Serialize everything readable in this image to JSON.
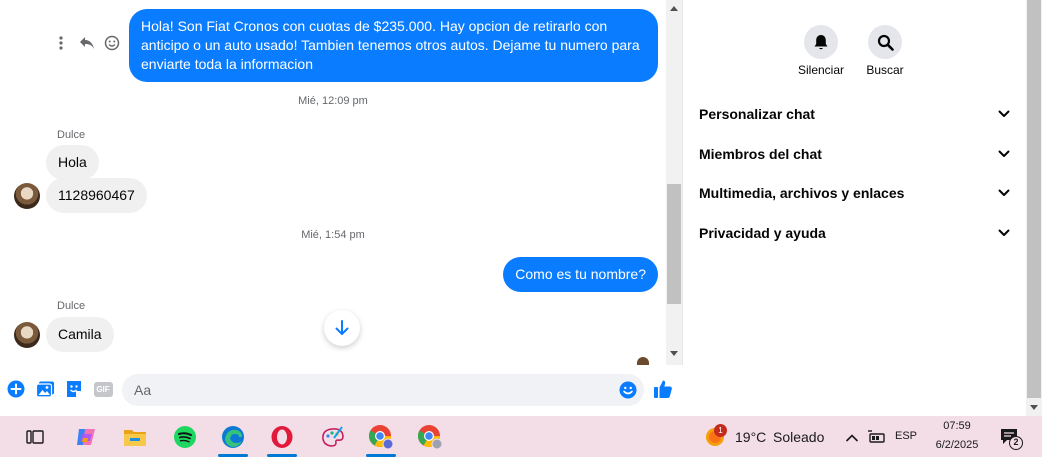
{
  "chat": {
    "messages": {
      "outgoing_1": "Hola! Son Fiat Cronos con cuotas de $235.000. Hay opcion de retirarlo con anticipo o un auto usado! Tambien tenemos otros autos. Dejame tu numero para enviarte toda la informacion",
      "timestamp_1": "Mié, 12:09 pm",
      "sender_1": "Dulce",
      "incoming_1": "Hola",
      "incoming_2": "1128960467",
      "timestamp_2": "Mié, 1:54 pm",
      "outgoing_2": "Como es tu nombre?",
      "sender_2": "Dulce",
      "incoming_3": "Camila"
    },
    "actions": [
      "more-icon",
      "reply-icon",
      "emoji-icon"
    ],
    "composer": {
      "placeholder": "Aa",
      "icons": [
        "plus-icon",
        "image-icon",
        "sticker-icon",
        "gif-icon",
        "emoji-icon",
        "like-icon"
      ],
      "gif_label": "GIF"
    }
  },
  "info_panel": {
    "buttons": [
      {
        "label": "Silenciar",
        "icon": "bell-icon"
      },
      {
        "label": "Buscar",
        "icon": "search-icon"
      }
    ],
    "sections": [
      "Personalizar chat",
      "Miembros del chat",
      "Multimedia, archivos y enlaces",
      "Privacidad y ayuda"
    ]
  },
  "taskbar": {
    "apps": [
      "task-view-icon",
      "copilot-icon",
      "file-explorer-icon",
      "spotify-icon",
      "edge-icon",
      "opera-icon",
      "paint-icon",
      "chrome-profile-icon",
      "chrome-icon"
    ],
    "weather": {
      "badge": "1",
      "temp": "19°C",
      "condition": "Soleado"
    },
    "language": "ESP",
    "time": "07:59",
    "date": "6/2/2025",
    "notification_count": "2"
  },
  "colors": {
    "accent": "#0a7cff",
    "bubble_in": "#f0f0f0",
    "taskbar": "#f3dde6"
  }
}
